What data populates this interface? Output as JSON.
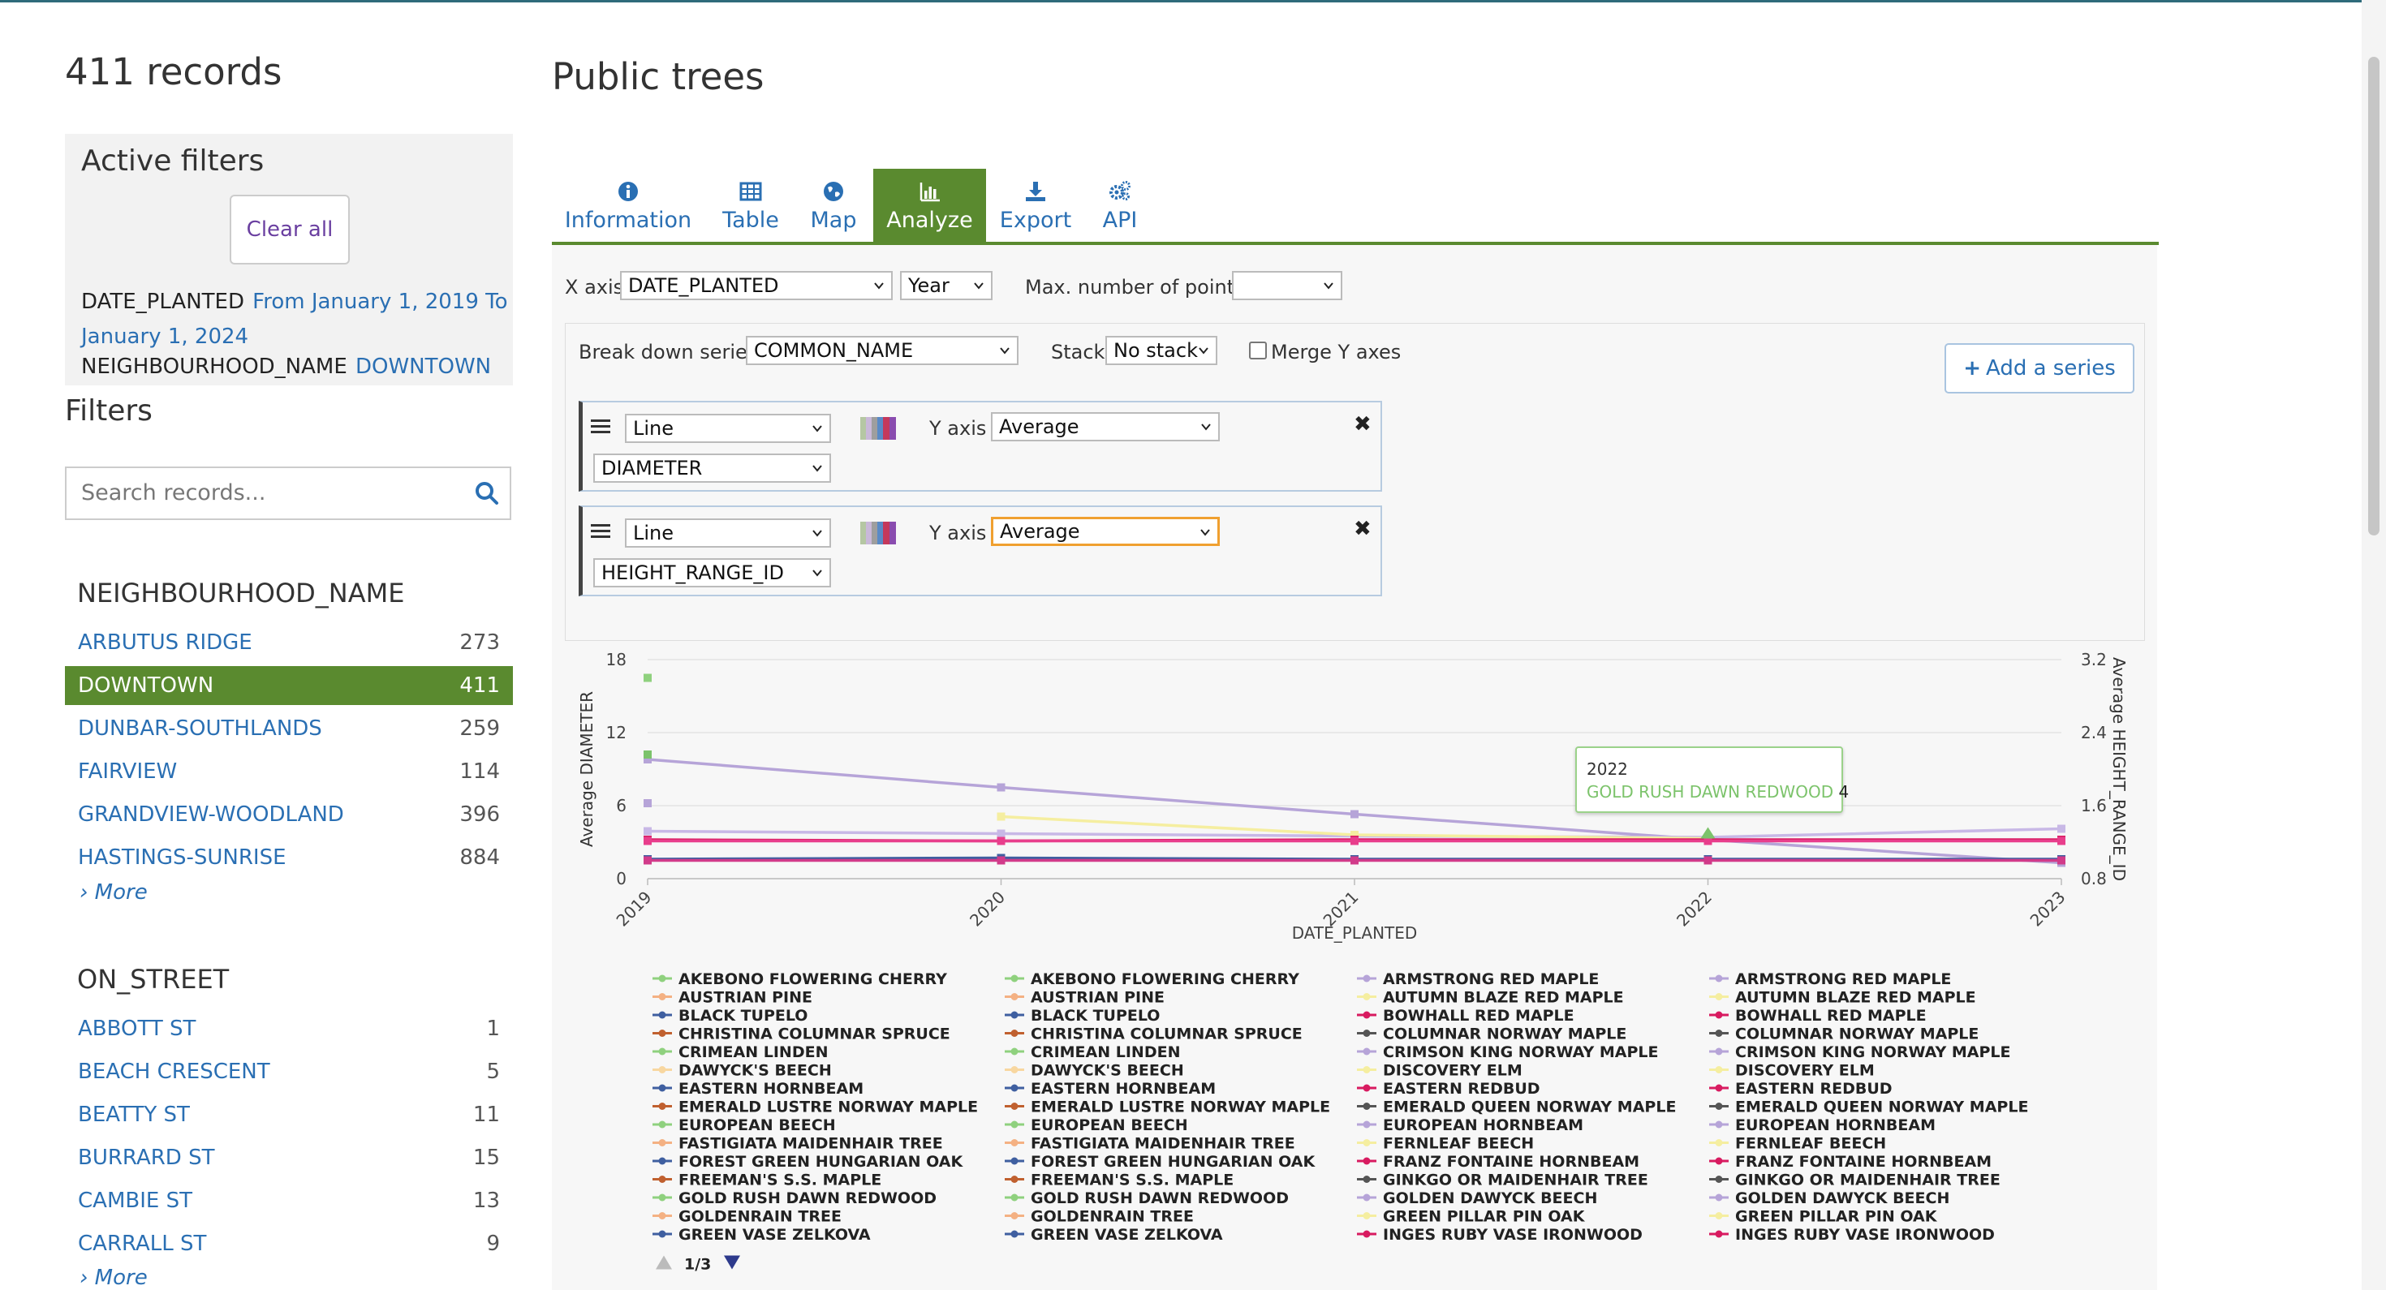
{
  "sidebar": {
    "records_title": "411 records",
    "active_filters": {
      "title": "Active filters",
      "clear_label": "Clear all",
      "items": [
        {
          "key": "DATE_PLANTED",
          "value": "From January 1, 2019 To January 1, 2024"
        },
        {
          "key": "NEIGHBOURHOOD_NAME",
          "value": "DOWNTOWN"
        }
      ]
    },
    "filters_title": "Filters",
    "search_placeholder": "Search records...",
    "facets": [
      {
        "title": "NEIGHBOURHOOD_NAME",
        "items": [
          {
            "label": "ARBUTUS RIDGE",
            "count": "273",
            "selected": false
          },
          {
            "label": "DOWNTOWN",
            "count": "411",
            "selected": true
          },
          {
            "label": "DUNBAR-SOUTHLANDS",
            "count": "259",
            "selected": false
          },
          {
            "label": "FAIRVIEW",
            "count": "114",
            "selected": false
          },
          {
            "label": "GRANDVIEW-WOODLAND",
            "count": "396",
            "selected": false
          },
          {
            "label": "HASTINGS-SUNRISE",
            "count": "884",
            "selected": false
          }
        ],
        "more": "› More"
      },
      {
        "title": "ON_STREET",
        "items": [
          {
            "label": "ABBOTT ST",
            "count": "1",
            "selected": false
          },
          {
            "label": "BEACH CRESCENT",
            "count": "5",
            "selected": false
          },
          {
            "label": "BEATTY ST",
            "count": "11",
            "selected": false
          },
          {
            "label": "BURRARD ST",
            "count": "15",
            "selected": false
          },
          {
            "label": "CAMBIE ST",
            "count": "13",
            "selected": false
          },
          {
            "label": "CARRALL ST",
            "count": "9",
            "selected": false
          }
        ],
        "more": "› More"
      }
    ]
  },
  "main": {
    "title": "Public trees",
    "tabs": [
      {
        "label": "Information",
        "icon": "info-icon",
        "active": false
      },
      {
        "label": "Table",
        "icon": "table-icon",
        "active": false
      },
      {
        "label": "Map",
        "icon": "globe-icon",
        "active": false
      },
      {
        "label": "Analyze",
        "icon": "bar-chart-icon",
        "active": true
      },
      {
        "label": "Export",
        "icon": "download-icon",
        "active": false
      },
      {
        "label": "API",
        "icon": "gears-icon",
        "active": false
      }
    ],
    "controls": {
      "x_axis_label": "X axis",
      "x_axis_value": "DATE_PLANTED",
      "x_period_value": "Year",
      "max_points_label": "Max. number of points",
      "max_points_value": "",
      "breakdown_label": "Break down series",
      "breakdown_value": "COMMON_NAME",
      "stack_label": "Stack",
      "stack_value": "No stack",
      "merge_label": "Merge Y axes",
      "add_series_label": "Add a series",
      "series": [
        {
          "type": "Line",
          "y_axis_label": "Y axis",
          "aggregation": "Average",
          "field": "DIAMETER"
        },
        {
          "type": "Line",
          "y_axis_label": "Y axis",
          "aggregation": "Average",
          "field": "HEIGHT_RANGE_ID"
        }
      ]
    },
    "tooltip": {
      "title": "2022",
      "series": "GOLD RUSH DAWN REDWOOD",
      "value": "4"
    },
    "pagination": "1/3"
  },
  "colors": {
    "accent_green": "#5a8a2f",
    "link_blue": "#2a6fb3"
  },
  "chart_data": {
    "type": "line",
    "xlabel": "DATE_PLANTED",
    "ylabel_left": "Average DIAMETER",
    "ylabel_right": "Average HEIGHT_RANGE_ID",
    "x": [
      "2019",
      "2020",
      "2021",
      "2022",
      "2023"
    ],
    "y_left_ticks": [
      "18",
      "12",
      "6",
      "0"
    ],
    "y_left_range": [
      0,
      18
    ],
    "y_right_ticks": [
      "3.2",
      "2.4",
      "1.6",
      "0.8"
    ],
    "y_right_range": [
      0.8,
      3.2
    ],
    "grid": true,
    "legend_placement": "bottom",
    "series": [
      {
        "values": [
          9.8,
          7.5,
          5.3,
          3.2,
          1.3
        ],
        "color": "#b6a4d8"
      },
      {
        "values": [
          3.9,
          3.7,
          3.5,
          3.4,
          4.1
        ],
        "color": "#c8b8e6"
      },
      {
        "values": [
          null,
          5.1,
          3.6,
          3.3,
          null
        ],
        "color": "#f5eea0"
      },
      {
        "values": [
          3.2,
          3.1,
          3.2,
          3.2,
          3.2
        ],
        "color": "#d81b60"
      },
      {
        "values": [
          3.1,
          3.1,
          3.1,
          3.1,
          3.1
        ],
        "color": "#e83e8c"
      },
      {
        "values": [
          1.6,
          1.7,
          1.6,
          1.6,
          1.6
        ],
        "color": "#3f5fa0"
      },
      {
        "values": [
          1.5,
          1.5,
          1.5,
          1.5,
          1.5
        ],
        "color": "#d13b8a"
      },
      {
        "values": [
          16.5,
          null,
          null,
          null,
          null
        ],
        "color": "#8fd17e"
      },
      {
        "values": [
          10.2,
          null,
          null,
          null,
          null
        ],
        "color": "#7cc36b"
      },
      {
        "values": [
          6.2,
          null,
          null,
          null,
          null
        ],
        "color": "#b6a4d8"
      }
    ],
    "legend": [
      [
        "AKEBONO FLOWERING CHERRY",
        "AKEBONO FLOWERING CHERRY",
        "ARMSTRONG RED MAPLE",
        "ARMSTRONG RED MAPLE"
      ],
      [
        "AUSTRIAN PINE",
        "AUSTRIAN PINE",
        "AUTUMN BLAZE RED MAPLE",
        "AUTUMN BLAZE RED MAPLE"
      ],
      [
        "BLACK TUPELO",
        "BLACK TUPELO",
        "BOWHALL RED MAPLE",
        "BOWHALL RED MAPLE"
      ],
      [
        "CHRISTINA COLUMNAR SPRUCE",
        "CHRISTINA COLUMNAR SPRUCE",
        "COLUMNAR NORWAY MAPLE",
        "COLUMNAR NORWAY MAPLE"
      ],
      [
        "CRIMEAN LINDEN",
        "CRIMEAN LINDEN",
        "CRIMSON KING NORWAY MAPLE",
        "CRIMSON KING NORWAY MAPLE"
      ],
      [
        "DAWYCK'S BEECH",
        "DAWYCK'S BEECH",
        "DISCOVERY ELM",
        "DISCOVERY ELM"
      ],
      [
        "EASTERN HORNBEAM",
        "EASTERN HORNBEAM",
        "EASTERN REDBUD",
        "EASTERN REDBUD"
      ],
      [
        "EMERALD LUSTRE NORWAY MAPLE",
        "EMERALD LUSTRE NORWAY MAPLE",
        "EMERALD QUEEN NORWAY MAPLE",
        "EMERALD QUEEN NORWAY MAPLE"
      ],
      [
        "EUROPEAN BEECH",
        "EUROPEAN BEECH",
        "EUROPEAN HORNBEAM",
        "EUROPEAN HORNBEAM"
      ],
      [
        "FASTIGIATA MAIDENHAIR TREE",
        "FASTIGIATA MAIDENHAIR TREE",
        "FERNLEAF BEECH",
        "FERNLEAF BEECH"
      ],
      [
        "FOREST GREEN HUNGARIAN OAK",
        "FOREST GREEN HUNGARIAN OAK",
        "FRANZ FONTAINE HORNBEAM",
        "FRANZ FONTAINE HORNBEAM"
      ],
      [
        "FREEMAN'S S.S. MAPLE",
        "FREEMAN'S S.S. MAPLE",
        "GINKGO OR MAIDENHAIR TREE",
        "GINKGO OR MAIDENHAIR TREE"
      ],
      [
        "GOLD RUSH DAWN REDWOOD",
        "GOLD RUSH DAWN REDWOOD",
        "GOLDEN DAWYCK BEECH",
        "GOLDEN DAWYCK BEECH"
      ],
      [
        "GOLDENRAIN TREE",
        "GOLDENRAIN TREE",
        "GREEN PILLAR PIN OAK",
        "GREEN PILLAR PIN OAK"
      ],
      [
        "GREEN VASE ZELKOVA",
        "GREEN VASE ZELKOVA",
        "INGES RUBY VASE IRONWOOD",
        "INGES RUBY VASE IRONWOOD"
      ]
    ],
    "legend_colors": [
      [
        "#8fd17e",
        "#8fd17e",
        "#b6a4d8",
        "#b6a4d8"
      ],
      [
        "#f4b183",
        "#f4b183",
        "#f5eea0",
        "#f5eea0"
      ],
      [
        "#3f5fa0",
        "#3f5fa0",
        "#d81b60",
        "#d81b60"
      ],
      [
        "#c0602f",
        "#c0602f",
        "#555555",
        "#555555"
      ],
      [
        "#8fd17e",
        "#8fd17e",
        "#b6a4d8",
        "#b6a4d8"
      ],
      [
        "#f8d7a0",
        "#f8d7a0",
        "#f5eea0",
        "#f5eea0"
      ],
      [
        "#3f5fa0",
        "#3f5fa0",
        "#d81b60",
        "#d81b60"
      ],
      [
        "#c0602f",
        "#c0602f",
        "#555555",
        "#555555"
      ],
      [
        "#8fd17e",
        "#8fd17e",
        "#b6a4d8",
        "#b6a4d8"
      ],
      [
        "#f4b183",
        "#f4b183",
        "#f5eea0",
        "#f5eea0"
      ],
      [
        "#3f5fa0",
        "#3f5fa0",
        "#d81b60",
        "#d81b60"
      ],
      [
        "#c0602f",
        "#c0602f",
        "#555555",
        "#555555"
      ],
      [
        "#8fd17e",
        "#8fd17e",
        "#b6a4d8",
        "#b6a4d8"
      ],
      [
        "#f4b183",
        "#f4b183",
        "#f5eea0",
        "#f5eea0"
      ],
      [
        "#3f5fa0",
        "#3f5fa0",
        "#d81b60",
        "#d81b60"
      ]
    ]
  }
}
